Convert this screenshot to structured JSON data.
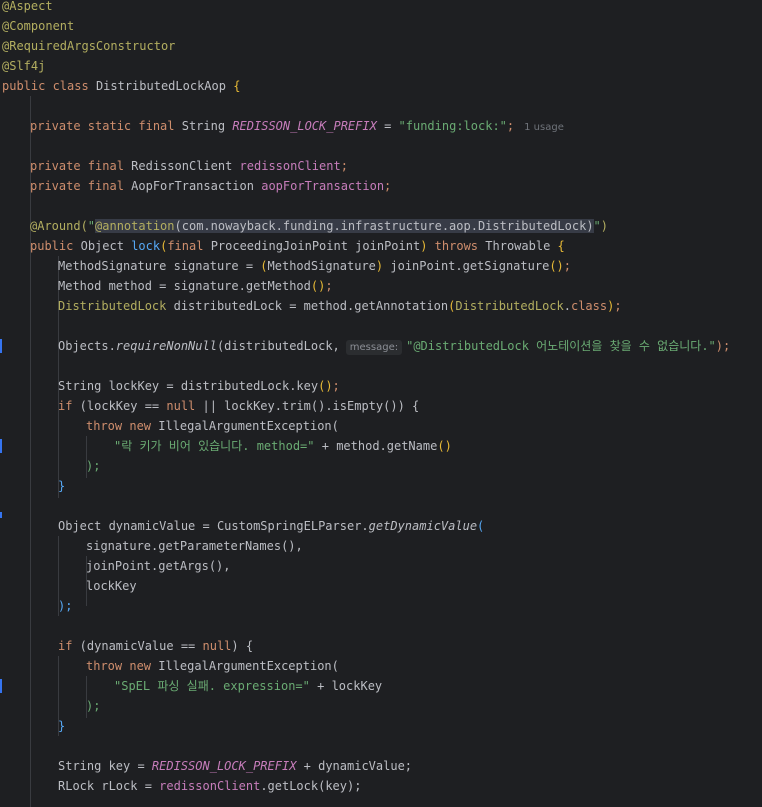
{
  "annotations": {
    "aspect": "@Aspect",
    "component": "@Component",
    "ctor": "@RequiredArgsConstructor",
    "slf4j": "@Slf4j"
  },
  "class_decl": {
    "mods": "public class",
    "name": "DistributedLockAop",
    "brace": "{"
  },
  "field_prefix": {
    "mods": "private static final",
    "type": "String",
    "name": "REDISSON_LOCK_PREFIX",
    "eq": "=",
    "value": "\"funding:lock:\"",
    "semi": ";",
    "usage_hint": "1 usage"
  },
  "field_client": {
    "mods": "private final",
    "type": "RedissonClient",
    "name": "redissonClient",
    "semi": ";"
  },
  "field_aop": {
    "mods": "private final",
    "type": "AopForTransaction",
    "name": "aopForTransaction",
    "semi": ";"
  },
  "around": {
    "ann": "@Around(",
    "q1": "\"",
    "inner_ann": "@annotation",
    "inner_rest": "(com.nowayback.funding.infrastructure.aop.DistributedLock)",
    "q2": "\"",
    "close": ")"
  },
  "method_decl": {
    "mods": "public",
    "ret": "Object",
    "name": "lock",
    "open": "(",
    "param_mod": "final",
    "param": "ProceedingJoinPoint joinPoint",
    "close": ")",
    "throws": "throws",
    "exc": "Throwable",
    "brace": "{"
  },
  "l_sig": {
    "a": "MethodSignature signature = ",
    "p1": "(",
    "b": "MethodSignature",
    "p2": ")",
    "c": " joinPoint.getSignature",
    "d": "()",
    "e": ";"
  },
  "l_method": {
    "a": "Method method = signature.getMethod",
    "d": "()",
    "e": ";"
  },
  "l_dl": {
    "type": "DistributedLock",
    "a": " distributedLock = method.getAnnotation",
    "p1": "(",
    "type2": "DistributedLock",
    "dot": ".",
    "cls": "class",
    "p2": ")",
    "e": ";"
  },
  "l_nonnull": {
    "a": "Objects.",
    "fn": "requireNonNull",
    "b": "(distributedLock,",
    "hint": "message:",
    "str": "\"@DistributedLock 어노테이션을 찾을 수 없습니다.\"",
    "e": ");"
  },
  "l_lockkey": {
    "a": "String lockKey = distributedLock.key",
    "d": "()",
    "e": ";"
  },
  "l_if1": {
    "kw": "if",
    "a": " (lockKey == ",
    "null": "null",
    "b": " || lockKey.trim",
    "c": "().isEmpty()) {"
  },
  "l_throw1": {
    "kw": "throw new",
    "a": " IllegalArgumentException("
  },
  "l_str1": {
    "str": "\"락 키가 비어 있습니다. method=\"",
    "a": " + method.getName",
    "d": "()"
  },
  "l_close_paren1": ");",
  "l_close_brace1": "}",
  "l_dyn": {
    "a": "Object dynamicValue = CustomSpringELParser.",
    "fn": "getDynamicValue",
    "p": "("
  },
  "l_args1": "signature.getParameterNames(),",
  "l_args2": "joinPoint.getArgs(),",
  "l_args3": "lockKey",
  "l_close_paren2": ");",
  "l_if2": {
    "kw": "if",
    "a": " (dynamicValue == ",
    "null": "null",
    "b": ") {"
  },
  "l_throw2": {
    "kw": "throw new",
    "a": " IllegalArgumentException("
  },
  "l_str2": {
    "str": "\"SpEL 파싱 실패. expression=\"",
    "a": " + lockKey"
  },
  "l_close_paren3": ");",
  "l_close_brace2": "}",
  "l_key": {
    "a": "String key = ",
    "const": "REDISSON_LOCK_PREFIX",
    "b": " + dynamicValue;"
  },
  "l_rlock": {
    "a": "RLock rLock = ",
    "field": "redissonClient",
    "b": ".getLock(key);"
  },
  "colors": {
    "background": "#1e1f22",
    "keyword": "#cf8e6d",
    "annotation": "#b3ae60",
    "string": "#6aab73",
    "constant": "#c77dbb",
    "method_decl": "#56a8f5",
    "text": "#bcbec4"
  }
}
